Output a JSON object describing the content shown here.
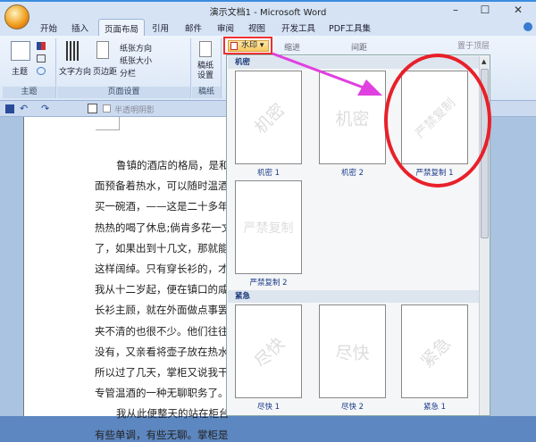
{
  "window": {
    "title": "演示文档1 - Microsoft Word",
    "minimize": "–",
    "maximize": "☐",
    "close": "✕"
  },
  "tabs": [
    "开始",
    "插入",
    "页面布局",
    "引用",
    "邮件",
    "审阅",
    "视图",
    "开发工具",
    "PDF工具集"
  ],
  "active_tab": "页面布局",
  "ribbon": {
    "theme_group": {
      "label": "主题",
      "theme_button": "主题"
    },
    "page_setup": {
      "label": "页面设置",
      "text_direction": "文字方向",
      "margins": "页边距",
      "orientation": "纸张方向",
      "size": "纸张大小",
      "columns": "分栏"
    },
    "draft": {
      "label": "稿纸",
      "button": "稿纸设置"
    },
    "watermark": "水印",
    "indent": "缩进",
    "spacing": "间距",
    "bring_front": "置于顶层"
  },
  "qat": {
    "shadow_checkbox": "半透明阴影"
  },
  "document": {
    "lines": [
      "鲁镇的酒店的格局，是和别",
      "面预备着热水，可以随时温酒。",
      "买一碗酒，——这是二十多年前",
      "热热的喝了休息;倘肯多花一文",
      "了，如果出到十几文，那就能买",
      "这样阔绰。只有穿长衫的，才踱",
      "我从十二岁起，便在镇口的咸亨",
      "长衫主顾，就在外面做点事罢。",
      "夹不清的也很不少。他们往往要",
      "没有，又亲看将壶子放在热水里",
      "所以过了几天，掌柜又说我干不",
      "专管温酒的一种无聊职务了。",
      "我从此便整天的站在柜台里",
      "有些单调，有些无聊。掌柜是一"
    ]
  },
  "watermark_gallery": {
    "sections": [
      {
        "title": "机密",
        "items": [
          {
            "label": "机密 1",
            "text": "机密",
            "style": "diagonal"
          },
          {
            "label": "机密 2",
            "text": "机密",
            "style": "horizontal"
          },
          {
            "label": "严禁复制 1",
            "text": "严禁复制",
            "style": "diagonal"
          },
          {
            "label": "严禁复制 2",
            "text": "严禁复制",
            "style": "horizontal"
          }
        ]
      },
      {
        "title": "紧急",
        "items": [
          {
            "label": "尽快 1",
            "text": "尽快",
            "style": "diagonal"
          },
          {
            "label": "尽快 2",
            "text": "尽快",
            "style": "horizontal"
          },
          {
            "label": "紧急 1",
            "text": "紧急",
            "style": "diagonal"
          }
        ]
      }
    ],
    "highlight_color": "#e8202a",
    "arrow_color": "#e040e0"
  }
}
